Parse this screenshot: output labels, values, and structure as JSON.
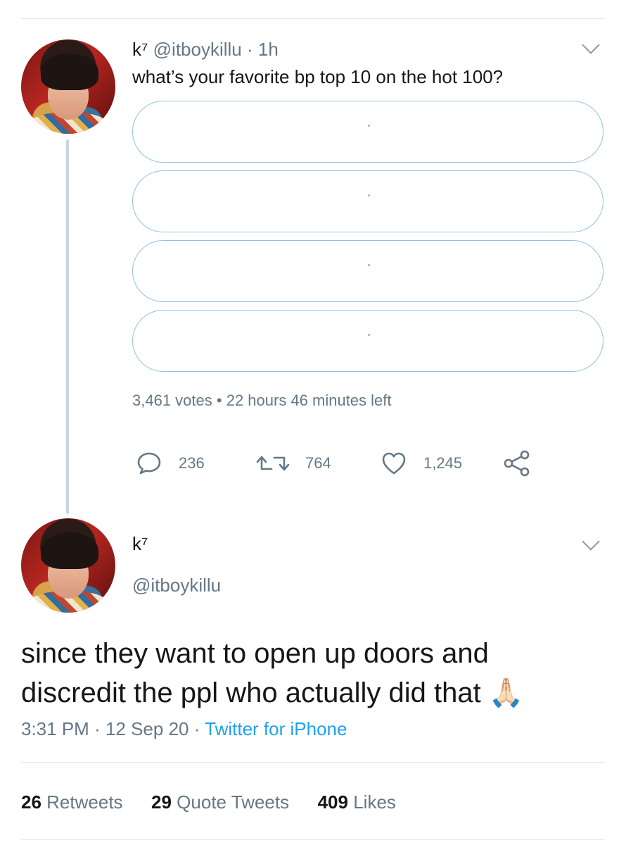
{
  "tweet": {
    "display_name": "k⁷",
    "handle": "@itboykillu",
    "time_ago": "· 1h",
    "text": "what’s your favorite bp top 10 on the hot 100?",
    "poll": {
      "options": [
        "",
        "",
        "",
        ""
      ],
      "votes": "3,461 votes",
      "separator": "•",
      "time_left": "22 hours 46 minutes left"
    },
    "actions": {
      "replies": "236",
      "retweets": "764",
      "likes": "1,245"
    }
  },
  "reply": {
    "display_name": "k⁷",
    "handle": "@itboykillu",
    "text": "since they want to open up doors and discredit the ppl who actually did that",
    "emoji": "🙏🏻",
    "time": "3:31 PM",
    "date": "· 12 Sep 20 ·",
    "source": "Twitter for iPhone",
    "stats": {
      "retweets_count": "26",
      "retweets_label": "Retweets",
      "quotes_count": "29",
      "quotes_label": "Quote Tweets",
      "likes_count": "409",
      "likes_label": "Likes"
    }
  },
  "colors": {
    "accent": "#1da1f2",
    "poll_border": "#8fc3e4",
    "muted": "#657786",
    "divider": "#e1e8ed"
  }
}
